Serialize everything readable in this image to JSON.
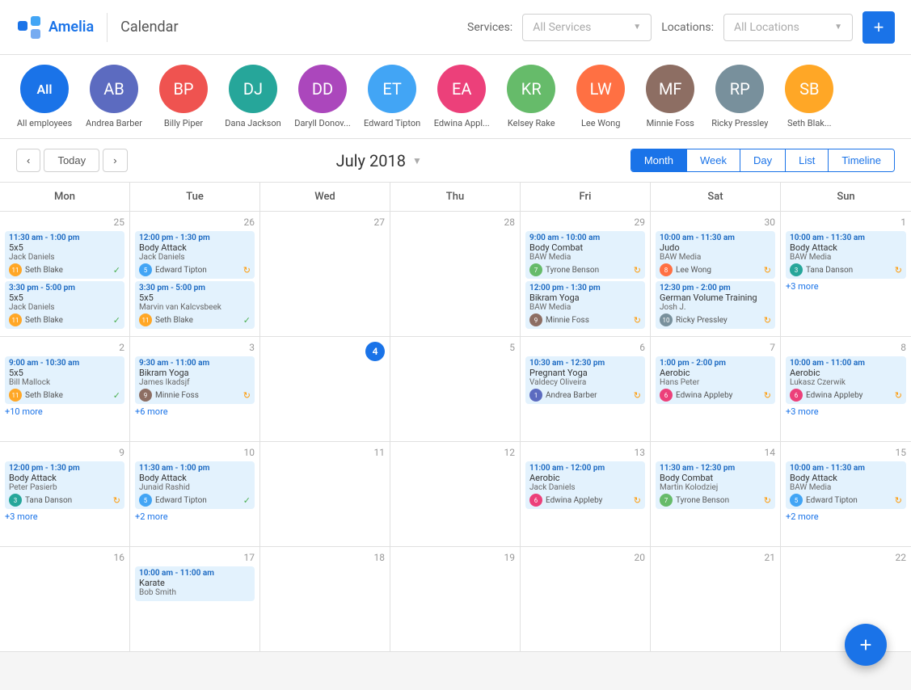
{
  "header": {
    "logo": "Amelia",
    "title": "Calendar",
    "services_label": "Services:",
    "services_placeholder": "All Services",
    "locations_label": "Locations:",
    "locations_placeholder": "All Locations",
    "add_label": "+"
  },
  "employees": [
    {
      "id": "all",
      "name": "All employees",
      "initials": "All",
      "color": "all"
    },
    {
      "id": "andrea",
      "name": "Andrea Barber",
      "initials": "AB",
      "color": "av1"
    },
    {
      "id": "billy",
      "name": "Billy Piper",
      "initials": "BP",
      "color": "av2"
    },
    {
      "id": "dana",
      "name": "Dana Jackson",
      "initials": "DJ",
      "color": "av3"
    },
    {
      "id": "daryll",
      "name": "Daryll Donov...",
      "initials": "DD",
      "color": "av4"
    },
    {
      "id": "edward",
      "name": "Edward Tipton",
      "initials": "ET",
      "color": "av5"
    },
    {
      "id": "edwina",
      "name": "Edwina Appl...",
      "initials": "EA",
      "color": "av6"
    },
    {
      "id": "kelsey",
      "name": "Kelsey Rake",
      "initials": "KR",
      "color": "av7"
    },
    {
      "id": "lee",
      "name": "Lee Wong",
      "initials": "LW",
      "color": "av8"
    },
    {
      "id": "minnie",
      "name": "Minnie Foss",
      "initials": "MF",
      "color": "av9"
    },
    {
      "id": "ricky",
      "name": "Ricky Pressley",
      "initials": "RP",
      "color": "av10"
    },
    {
      "id": "seth",
      "name": "Seth Blak...",
      "initials": "SB",
      "color": "av11"
    }
  ],
  "calendar": {
    "month_title": "July 2018",
    "view_buttons": [
      "Month",
      "Week",
      "Day",
      "List",
      "Timeline"
    ],
    "active_view": "Month",
    "days": [
      "Mon",
      "Tue",
      "Wed",
      "Thu",
      "Fri",
      "Sat",
      "Sun"
    ],
    "today_label": "Today"
  },
  "cells": [
    {
      "date": "25",
      "events": [
        {
          "time": "11:30 am - 1:00 pm",
          "name": "5x5",
          "org": "Jack Daniels",
          "person": "Seth Blake",
          "status": "check",
          "av": "av11"
        },
        {
          "time": "3:30 pm - 5:00 pm",
          "name": "5x5",
          "org": "Jack Daniels",
          "person": "Seth Blake",
          "status": "check",
          "av": "av11"
        }
      ]
    },
    {
      "date": "26",
      "events": [
        {
          "time": "12:00 pm - 1:30 pm",
          "name": "Body Attack",
          "org": "Jack Daniels",
          "person": "Edward Tipton",
          "status": "refresh",
          "av": "av5"
        },
        {
          "time": "3:30 pm - 5:00 pm",
          "name": "5x5",
          "org": "Marvin van Kalcvsbeek",
          "person": "Seth Blake",
          "status": "check",
          "av": "av11"
        }
      ]
    },
    {
      "date": "27",
      "events": []
    },
    {
      "date": "28",
      "events": []
    },
    {
      "date": "29",
      "events": [
        {
          "time": "9:00 am - 10:00 am",
          "name": "Body Combat",
          "org": "BAW Media",
          "person": "Tyrone Benson",
          "status": "refresh",
          "av": "av7"
        },
        {
          "time": "12:00 pm - 1:30 pm",
          "name": "Bikram Yoga",
          "org": "BAW Media",
          "person": "Minnie Foss",
          "status": "refresh",
          "av": "av9"
        }
      ]
    },
    {
      "date": "30",
      "events": [
        {
          "time": "10:00 am - 11:30 am",
          "name": "Judo",
          "org": "BAW Media",
          "person": "Lee Wong",
          "status": "refresh",
          "av": "av8"
        },
        {
          "time": "12:30 pm - 2:00 pm",
          "name": "German Volume Training",
          "org": "Josh J.",
          "person": "Ricky Pressley",
          "status": "refresh",
          "av": "av10"
        }
      ]
    },
    {
      "date": "1",
      "events": [
        {
          "time": "10:00 am - 11:30 am",
          "name": "Body Attack",
          "org": "BAW Media",
          "person": "Tana Danson",
          "status": "refresh",
          "av": "av3"
        }
      ],
      "more": "+3 more"
    },
    {
      "date": "2",
      "events": [
        {
          "time": "9:00 am - 10:30 am",
          "name": "5x5",
          "org": "Bill Mallock",
          "person": "Seth Blake",
          "status": "check",
          "av": "av11"
        }
      ],
      "more": "+10 more"
    },
    {
      "date": "3",
      "events": [
        {
          "time": "9:30 am - 11:00 am",
          "name": "Bikram Yoga",
          "org": "James Ikadsjf",
          "person": "Minnie Foss",
          "status": "refresh",
          "av": "av9"
        }
      ],
      "more": "+6 more"
    },
    {
      "date": "4",
      "today": true,
      "events": []
    },
    {
      "date": "5",
      "events": []
    },
    {
      "date": "6",
      "events": [
        {
          "time": "10:30 am - 12:30 pm",
          "name": "Pregnant Yoga",
          "org": "Valdecy Oliveira",
          "person": "Andrea Barber",
          "status": "refresh",
          "av": "av1"
        }
      ]
    },
    {
      "date": "7",
      "events": [
        {
          "time": "1:00 pm - 2:00 pm",
          "name": "Aerobic",
          "org": "Hans Peter",
          "person": "Edwina Appleby",
          "status": "refresh",
          "av": "av6"
        }
      ]
    },
    {
      "date": "8",
      "events": [
        {
          "time": "10:00 am - 11:00 am",
          "name": "Aerobic",
          "org": "Lukasz Czerwik",
          "person": "Edwina Appleby",
          "status": "refresh",
          "av": "av6"
        }
      ],
      "more": "+3 more"
    },
    {
      "date": "9",
      "events": [
        {
          "time": "12:00 pm - 1:30 pm",
          "name": "Body Attack",
          "org": "Peter Pasierb",
          "person": "Tana Danson",
          "status": "refresh",
          "av": "av3"
        }
      ],
      "more": "+3 more"
    },
    {
      "date": "10",
      "events": [
        {
          "time": "11:30 am - 1:00 pm",
          "name": "Body Attack",
          "org": "Junaid Rashid",
          "person": "Edward Tipton",
          "status": "check",
          "av": "av5"
        }
      ],
      "more": "+2 more"
    },
    {
      "date": "11",
      "events": []
    },
    {
      "date": "12",
      "events": []
    },
    {
      "date": "13",
      "events": [
        {
          "time": "11:00 am - 12:00 pm",
          "name": "Aerobic",
          "org": "Jack Daniels",
          "person": "Edwina Appleby",
          "status": "refresh",
          "av": "av6"
        }
      ]
    },
    {
      "date": "14",
      "events": [
        {
          "time": "11:30 am - 12:30 pm",
          "name": "Body Combat",
          "org": "Martin Kolodziej",
          "person": "Tyrone Benson",
          "status": "refresh",
          "av": "av7"
        }
      ]
    },
    {
      "date": "15",
      "events": [
        {
          "time": "10:00 am - 11:30 am",
          "name": "Body Attack",
          "org": "BAW Media",
          "person": "Edward Tipton",
          "status": "refresh",
          "av": "av5"
        }
      ],
      "more": "+2 more"
    },
    {
      "date": "16",
      "events": []
    },
    {
      "date": "17",
      "events": [
        {
          "time": "10:00 am - 11:00 am",
          "name": "Karate",
          "org": "Bob Smith",
          "person": "",
          "status": "",
          "av": ""
        }
      ]
    },
    {
      "date": "18",
      "events": []
    },
    {
      "date": "19",
      "events": []
    },
    {
      "date": "20",
      "events": []
    },
    {
      "date": "21",
      "events": []
    },
    {
      "date": "22",
      "events": []
    }
  ]
}
